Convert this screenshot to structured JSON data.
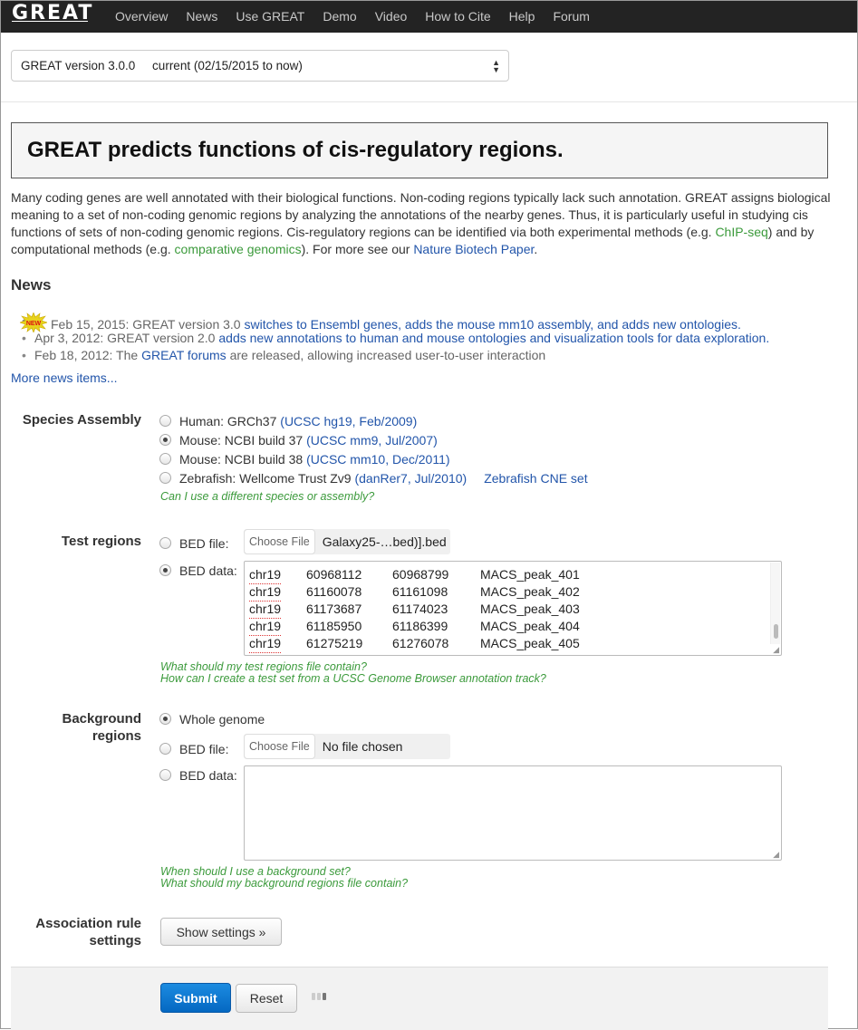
{
  "nav": {
    "logo": "GREAT",
    "items": [
      "Overview",
      "News",
      "Use GREAT",
      "Demo",
      "Video",
      "How to Cite",
      "Help",
      "Forum"
    ]
  },
  "version_select": {
    "selected": "GREAT version 3.0.0     current (02/15/2015 to now)"
  },
  "title": "GREAT predicts functions of cis-regulatory regions.",
  "intro": {
    "part1": "Many coding genes are well annotated with their biological functions. Non-coding regions typically lack such annotation. GREAT assigns biological meaning to a set of non-coding genomic regions by analyzing the annotations of the nearby genes. Thus, it is particularly useful in studying cis functions of sets of non-coding genomic regions. Cis-regulatory regions can be identified via both experimental methods (e.g. ",
    "chipseq": "ChIP-seq",
    "part2": ") and by computational methods (e.g. ",
    "comparative": "comparative genomics",
    "part3": "). For more see our ",
    "paper": "Nature Biotech Paper",
    "part4": "."
  },
  "news": {
    "heading": "News",
    "badge": "NEW",
    "items": [
      {
        "text": "Feb 15, 2015: GREAT version 3.0 ",
        "link": "switches to Ensembl genes, adds the mouse mm10 assembly, and adds new ontologies."
      },
      {
        "text": "Apr 3, 2012: GREAT version 2.0 ",
        "link": "adds new annotations to human and mouse ontologies and visualization tools for data exploration."
      },
      {
        "text": "Feb 18, 2012: The ",
        "link": "GREAT forums",
        "suffix": " are released, allowing increased user-to-user interaction"
      }
    ],
    "more": "More news items..."
  },
  "species": {
    "label": "Species Assembly",
    "options": [
      {
        "text": "Human: GRCh37 ",
        "link": "(UCSC hg19, Feb/2009)",
        "checked": false
      },
      {
        "text": "Mouse: NCBI build 37 ",
        "link": "(UCSC mm9, Jul/2007)",
        "checked": true
      },
      {
        "text": "Mouse: NCBI build 38 ",
        "link": "(UCSC mm10, Dec/2011)",
        "checked": false
      },
      {
        "text": "Zebrafish: Wellcome Trust Zv9 ",
        "link": "(danRer7, Jul/2010)",
        "extra": "Zebrafish CNE set",
        "checked": false
      }
    ],
    "help": "Can I use a different species or assembly?"
  },
  "test_regions": {
    "label": "Test regions",
    "bed_file_label": "BED file:",
    "choose_file": "Choose File",
    "file_name": "Galaxy25-…bed)].bed",
    "bed_data_label": "BED data:",
    "rows": [
      [
        "chr19",
        "60968112",
        "60968799",
        "MACS_peak_401"
      ],
      [
        "chr19",
        "61160078",
        "61161098",
        "MACS_peak_402"
      ],
      [
        "chr19",
        "61173687",
        "61174023",
        "MACS_peak_403"
      ],
      [
        "chr19",
        "61185950",
        "61186399",
        "MACS_peak_404"
      ],
      [
        "chr19",
        "61275219",
        "61276078",
        "MACS_peak_405"
      ]
    ],
    "help1": "What should my test regions file contain?",
    "help2": "How can I create a test set from a UCSC Genome Browser annotation track?"
  },
  "background": {
    "label_line1": "Background",
    "label_line2": "regions",
    "whole_genome": "Whole genome",
    "bed_file_label": "BED file:",
    "choose_file": "Choose File",
    "file_name": "No file chosen",
    "bed_data_label": "BED data:",
    "help1": "When should I use a background set?",
    "help2": "What should my background regions file contain?"
  },
  "association": {
    "label_line1": "Association rule",
    "label_line2": "settings",
    "button": "Show settings »"
  },
  "actions": {
    "submit": "Submit",
    "reset": "Reset"
  },
  "colors": {
    "link_blue": "#2255aa",
    "help_green": "#3b9a3b",
    "submit_blue": "#0a78d6",
    "nav_bg": "#232323"
  }
}
